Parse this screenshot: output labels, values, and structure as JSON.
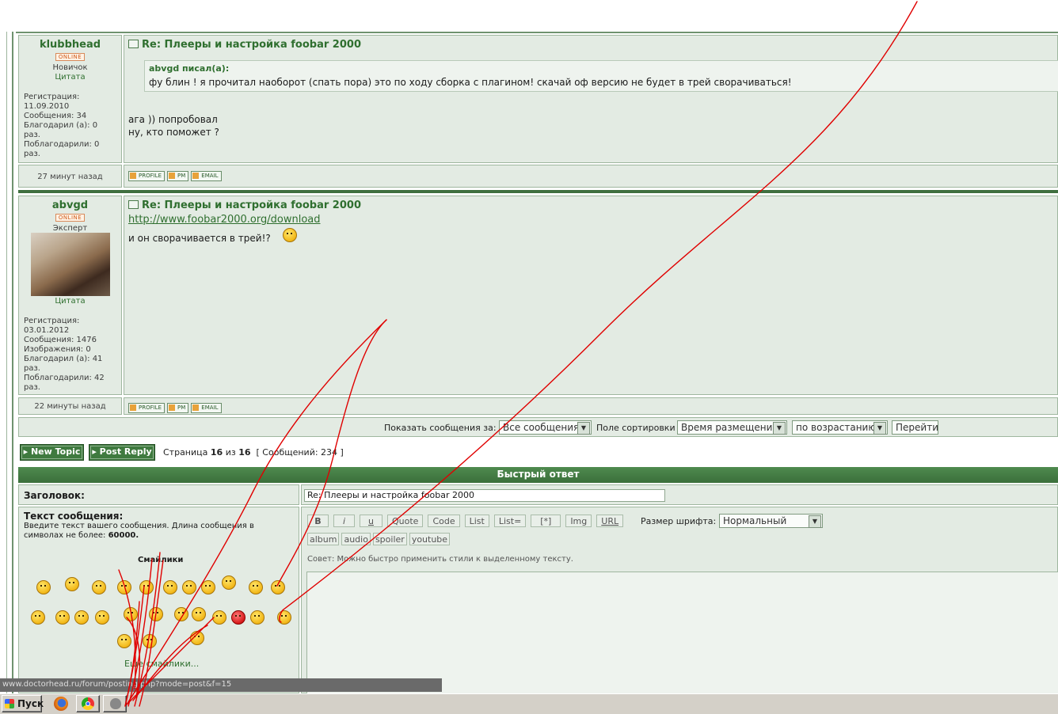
{
  "posts": [
    {
      "username": "klubbhead",
      "online": "ONLINE",
      "rank": "Новичок",
      "cite": "Цитата",
      "info": [
        "Регистрация:",
        "11.09.2010",
        "Сообщения: 34",
        "Благодарил (а): 0",
        "раз.",
        "Поблагодарили: 0",
        "раз."
      ],
      "title": "Re: Плееры и настройка foobar 2000",
      "quote_author": "abvgd писал(а):",
      "quote_text": "фу блин ! я прочитал наоборот (спать пора) это по ходу сборка с плагином! скачай оф версию не будет в трей сворачиваться!",
      "lines": [
        "ага )) попробовал",
        "ну, кто поможет ?"
      ],
      "time": "27 минут назад"
    },
    {
      "username": "abvgd",
      "online": "ONLINE",
      "rank": "Эксперт",
      "cite": "Цитата",
      "info": [
        "Регистрация:",
        "03.01.2012",
        "Сообщения: 1476",
        "Изображения: 0",
        "Благодарил (а): 41",
        "раз.",
        "Поблагодарили: 42",
        "раз."
      ],
      "title": "Re: Плееры и настройка foobar 2000",
      "link": "http://www.foobar2000.org/download",
      "line": "и он сворачивается в трей!?",
      "time": "22 минуты назад"
    }
  ],
  "post_buttons": [
    "PROFILE",
    "PM",
    "EMAIL"
  ],
  "sortbar": {
    "show_label": "Показать сообщения за:",
    "show_value": "Все сообщения",
    "sort_label": "Поле сортировки",
    "sort_value": "Время размещения",
    "order_value": "по возрастанию",
    "go_label": "Перейти"
  },
  "pagination": {
    "new_topic": "New Topic",
    "post_reply": "Post Reply",
    "page_prefix": "Страница",
    "page_current": "16",
    "page_of": "из",
    "page_total": "16",
    "messages": "[ Сообщений: 234 ]"
  },
  "quick_reply": {
    "header": "Быстрый ответ",
    "subject_label": "Заголовок:",
    "subject_value": "Re: Плееры и настройка foobar 2000",
    "message_label": "Текст сообщения:",
    "message_hint": "Введите текст вашего сообщения. Длина сообщения в символах не более:",
    "message_max": "60000.",
    "smilies_title": "Смайлики",
    "more_smilies": "Еще смайлики...",
    "buttons_row1": [
      "B",
      "i",
      "u",
      "Quote",
      "Code",
      "List",
      "List=",
      "[*]",
      "Img",
      "URL"
    ],
    "font_size_label": "Размер шрифта:",
    "font_size_value": "Нормальный",
    "buttons_row2": [
      "album",
      "audio",
      "spoiler",
      "youtube"
    ],
    "tip": "Совет: Можно быстро применить стили к выделенному тексту."
  },
  "status_url": "www.doctorhead.ru/forum/posting.php?mode=post&f=15",
  "taskbar": {
    "start_label": "Пуск"
  },
  "colors": {
    "forum_green": "#3f7a3f",
    "panel_bg": "#e3ebe3",
    "annotation_red": "#e00000"
  }
}
